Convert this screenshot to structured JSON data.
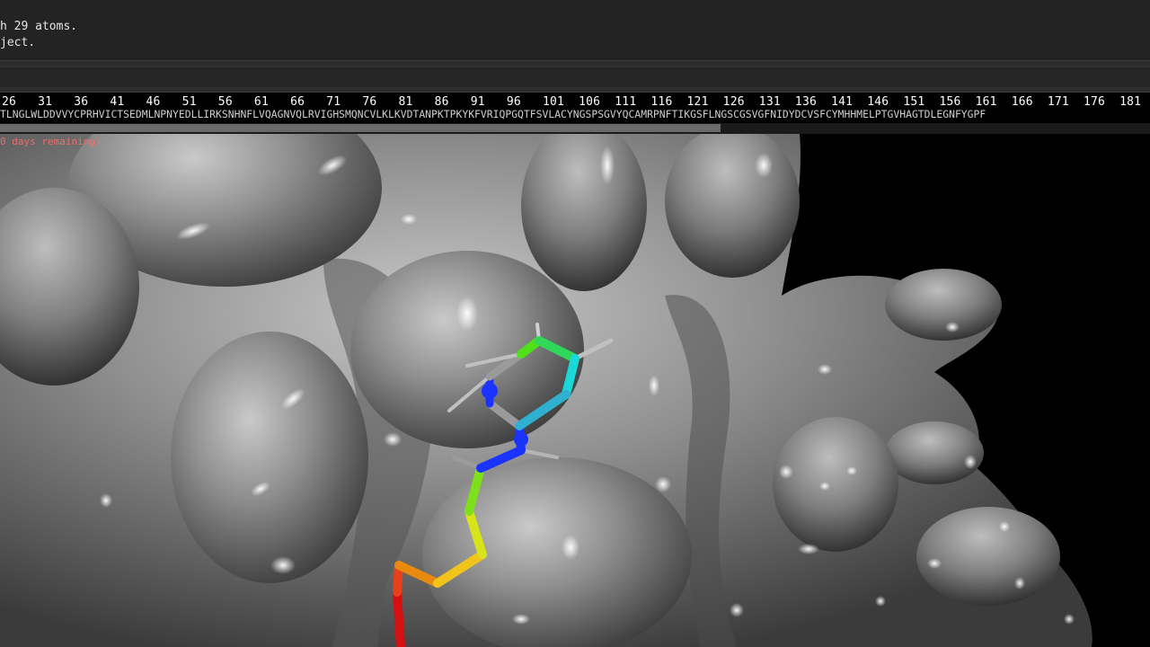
{
  "console": {
    "line1": "h 29 atoms.",
    "line2": "ject."
  },
  "sequence": {
    "numbers": "26   31   36   41   46   51   56   61   66   71   76   81   86   91   96   101  106  111  116  121  126  131  136  141  146  151  156  161  166  171  176  181",
    "letters": "TLNGLWLDDVVYCPRHVICTSEDMLNPNYEDLLIRKSNHNFLVQAGNVQLRVIGHSMQNCVLKLKVDTANPKTPKYKFVRIQPGQTFSVLACYNGSPSGVYQCAMRPNFTIKGSFLNGSCGSVGFNIDYDCVSFCYMHHMELPTGVHAGTDLEGNFYGPF"
  },
  "viewport": {
    "license_notice": "0 days remaining)"
  },
  "colors": {
    "console_bg": "#232323",
    "surface": "#8c8c8c",
    "nitrogen": "#1a33ff",
    "carbon": "#9a9a9a"
  }
}
